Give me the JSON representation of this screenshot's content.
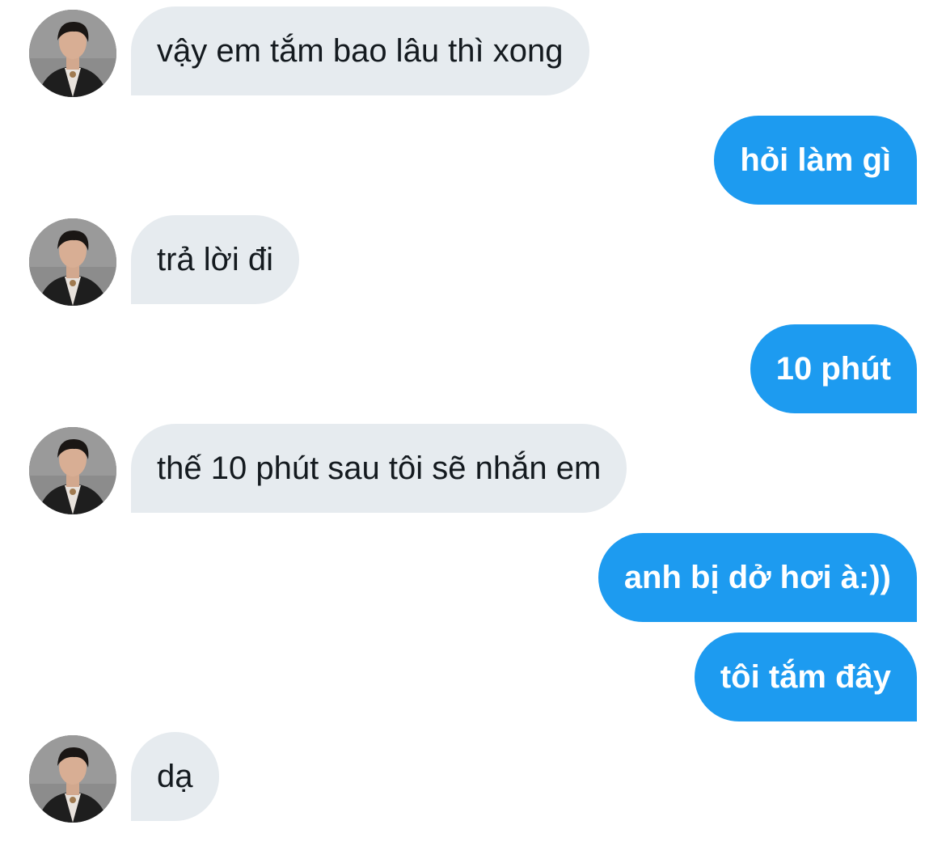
{
  "conversation": {
    "messages": [
      {
        "side": "in",
        "text": "vậy em tắm bao lâu thì xong",
        "avatar": "user-avatar-photo"
      },
      {
        "side": "out",
        "text": "hỏi làm gì"
      },
      {
        "side": "in",
        "text": "trả lời đi",
        "avatar": "user-avatar-photo"
      },
      {
        "side": "out",
        "text": "10 phút"
      },
      {
        "side": "in",
        "text": "thế 10 phút sau tôi sẽ nhắn em",
        "avatar": "user-avatar-photo"
      },
      {
        "side": "out",
        "text": "anh bị dở hơi à:))"
      },
      {
        "side": "out",
        "text": "tôi tắm đây"
      },
      {
        "side": "in",
        "text": "dạ",
        "avatar": "user-avatar-photo"
      }
    ]
  },
  "colors": {
    "incoming_bubble": "#e6ebef",
    "incoming_text": "#141a1f",
    "outgoing_bubble": "#1d9bf0",
    "outgoing_text": "#ffffff",
    "background": "#ffffff"
  }
}
